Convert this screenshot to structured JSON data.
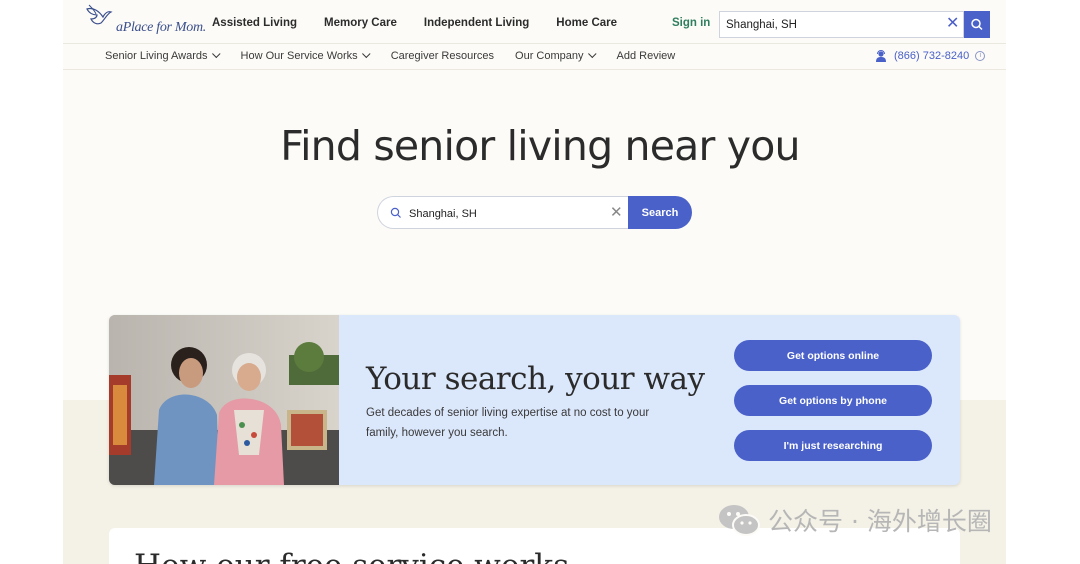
{
  "logo": {
    "text": "aPlace for Mom."
  },
  "primary_nav": [
    "Assisted Living",
    "Memory Care",
    "Independent Living",
    "Home Care"
  ],
  "header": {
    "signin_label": "Sign in",
    "search_value": "Shanghai, SH"
  },
  "subnav": {
    "items": [
      {
        "label": "Senior Living Awards",
        "dropdown": true
      },
      {
        "label": "How Our Service Works",
        "dropdown": true
      },
      {
        "label": "Caregiver Resources",
        "dropdown": false
      },
      {
        "label": "Our Company",
        "dropdown": true
      },
      {
        "label": "Add Review",
        "dropdown": false
      }
    ],
    "phone": "(866) 732-8240"
  },
  "hero": {
    "title": "Find senior living near you",
    "search_value": "Shanghai, SH",
    "search_button": "Search"
  },
  "card": {
    "title": "Your search, your way",
    "description": "Get decades of senior living expertise at no cost to your family, however you search.",
    "buttons": [
      "Get options online",
      "Get options by phone",
      "I'm just researching"
    ]
  },
  "second_card": {
    "title": "How our free service works"
  },
  "watermark": "公众号 · 海外增长圈",
  "colors": {
    "accent": "#4a61c9",
    "signin": "#2f7e5f",
    "card_bg": "#dbe7fb",
    "page_bg": "#fcfbf7"
  }
}
